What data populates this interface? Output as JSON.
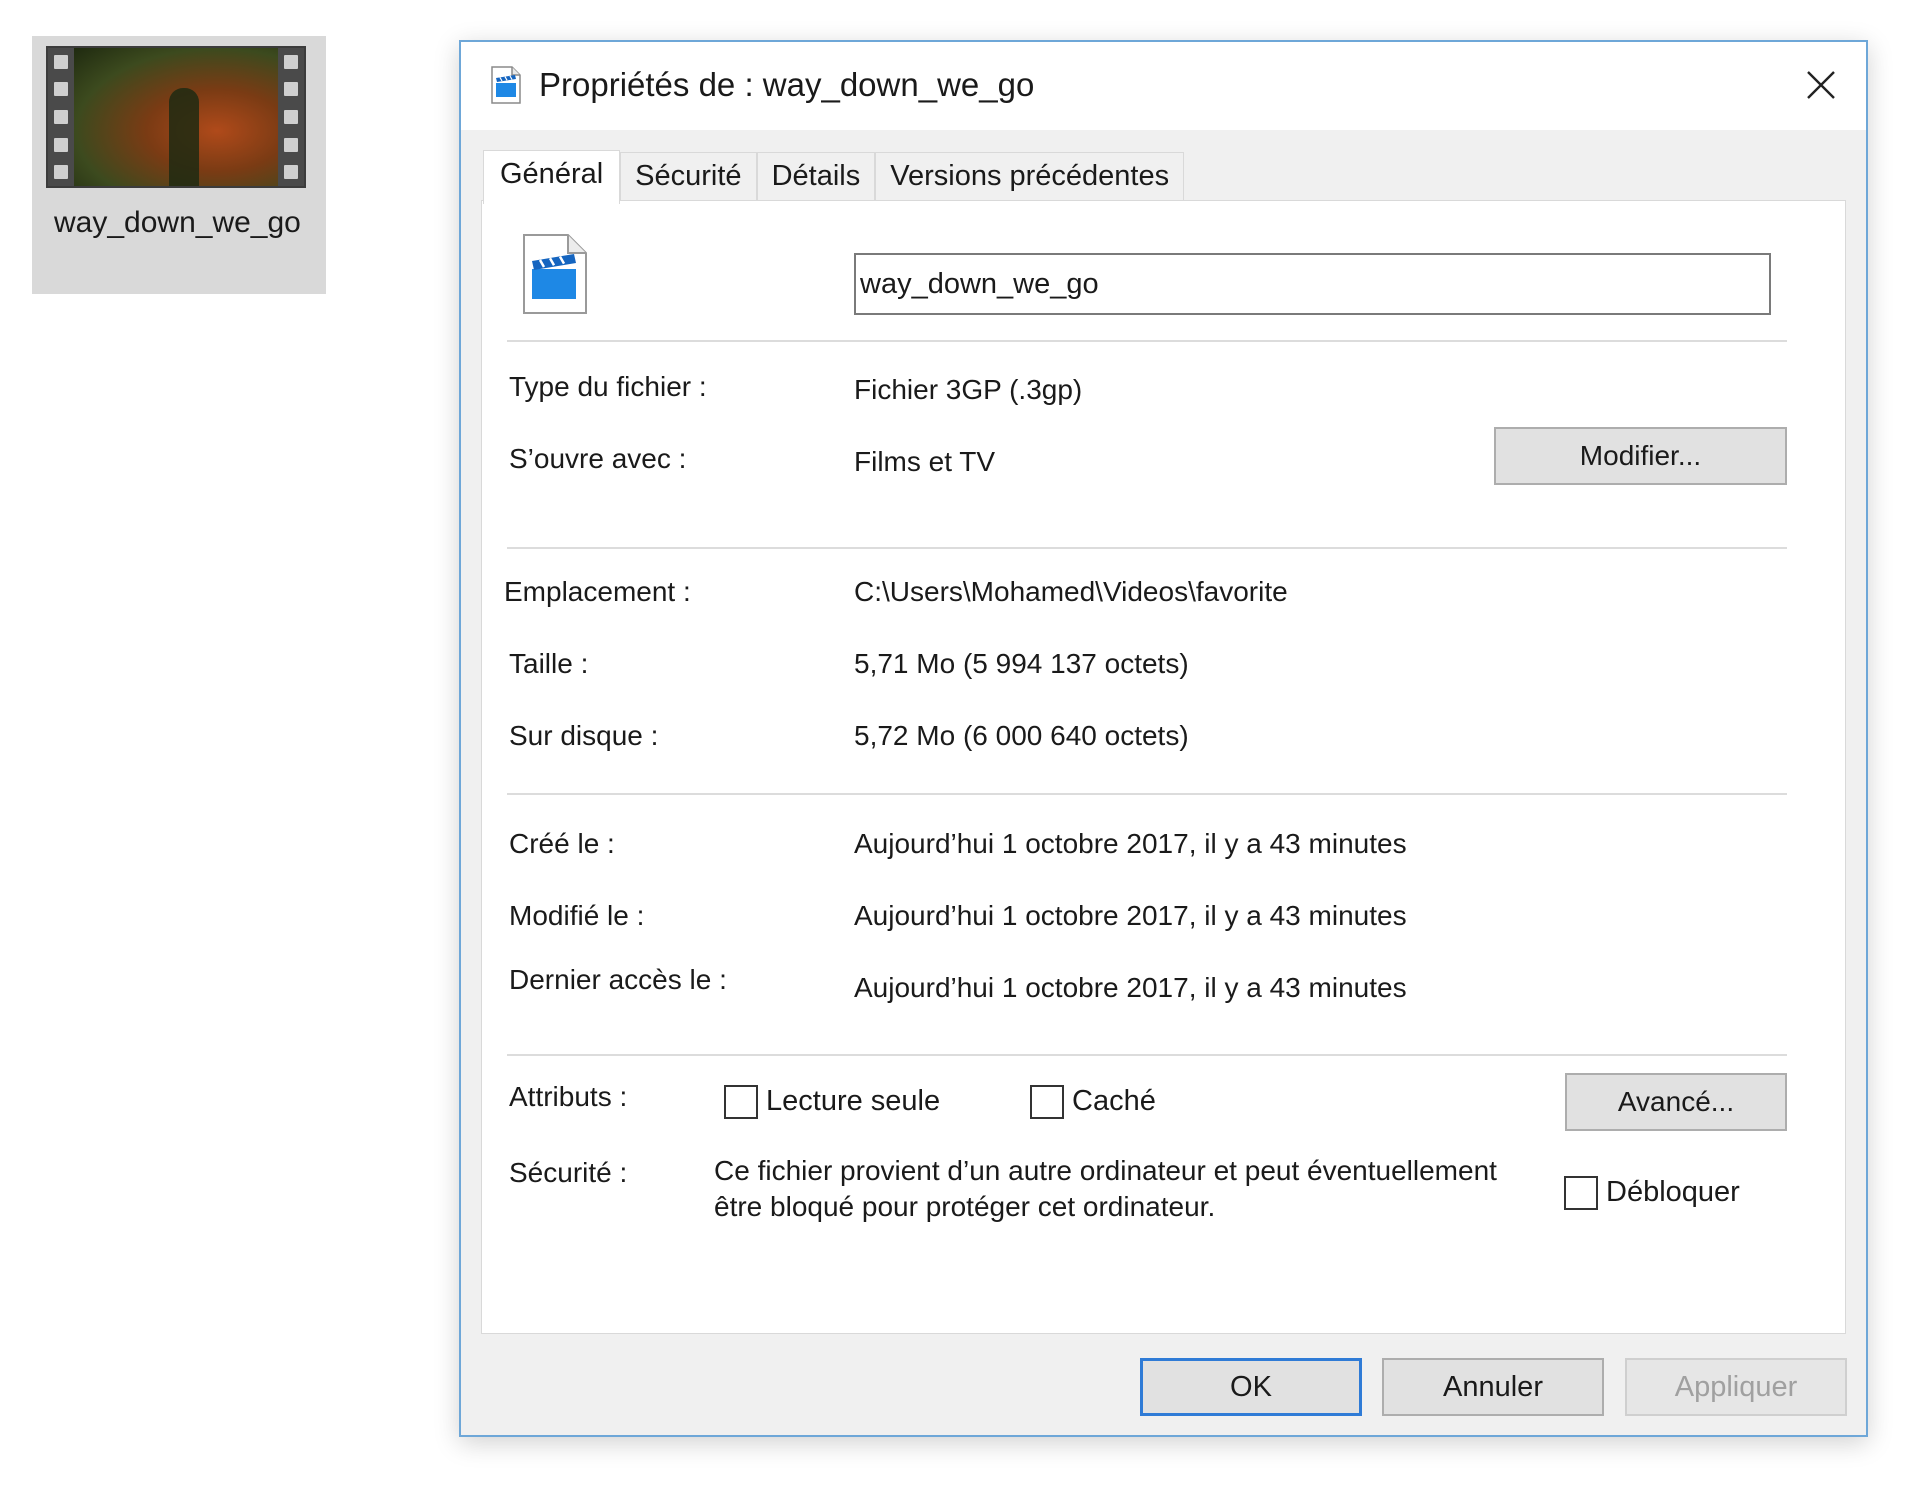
{
  "desktop": {
    "file_label": "way_down_we_go"
  },
  "dialog": {
    "title": "Propriétés de : way_down_we_go",
    "tabs": [
      {
        "label": "Général"
      },
      {
        "label": "Sécurité"
      },
      {
        "label": "Détails"
      },
      {
        "label": "Versions précédentes"
      }
    ],
    "active_tab": "Général",
    "file_name": "way_down_we_go",
    "fields": {
      "type_label": "Type du fichier :",
      "type_value": "Fichier 3GP (.3gp)",
      "opens_label": "S’ouvre avec :",
      "opens_value": "Films et TV",
      "change_button": "Modifier...",
      "location_label": "Emplacement :",
      "location_value": "C:\\Users\\Mohamed\\Videos\\favorite",
      "size_label": "Taille :",
      "size_value": "5,71 Mo (5 994 137 octets)",
      "disk_label": "Sur disque :",
      "disk_value": "5,72 Mo (6 000 640 octets)",
      "created_label": "Créé le :",
      "created_value": "Aujourd’hui 1 octobre 2017, il y a 43 minutes",
      "modified_label": "Modifié le :",
      "modified_value": "Aujourd’hui 1 octobre 2017, il y a 43 minutes",
      "accessed_label": "Dernier accès le :",
      "accessed_value": "Aujourd’hui 1 octobre 2017, il y a 43 minutes"
    },
    "attributes": {
      "label": "Attributs :",
      "readonly_label": "Lecture seule",
      "readonly_checked": false,
      "hidden_label": "Caché",
      "hidden_checked": false,
      "advanced_button": "Avancé..."
    },
    "security": {
      "label": "Sécurité :",
      "text": "Ce fichier provient d’un autre ordinateur et peut éventuellement être bloqué pour protéger cet ordinateur.",
      "unblock_label": "Débloquer",
      "unblock_checked": false
    },
    "footer": {
      "ok": "OK",
      "cancel": "Annuler",
      "apply": "Appliquer"
    }
  },
  "colors": {
    "accent": "#2f7bd6",
    "dialog_border": "#6ea7d8",
    "dialog_bg": "#f0f0f0",
    "panel_bg": "#ffffff",
    "disabled_text": "#a0a0a0"
  },
  "icons": {
    "video_file": "clapperboard-file-icon",
    "close": "close-icon",
    "thumbnail": "film-strip-thumbnail"
  }
}
